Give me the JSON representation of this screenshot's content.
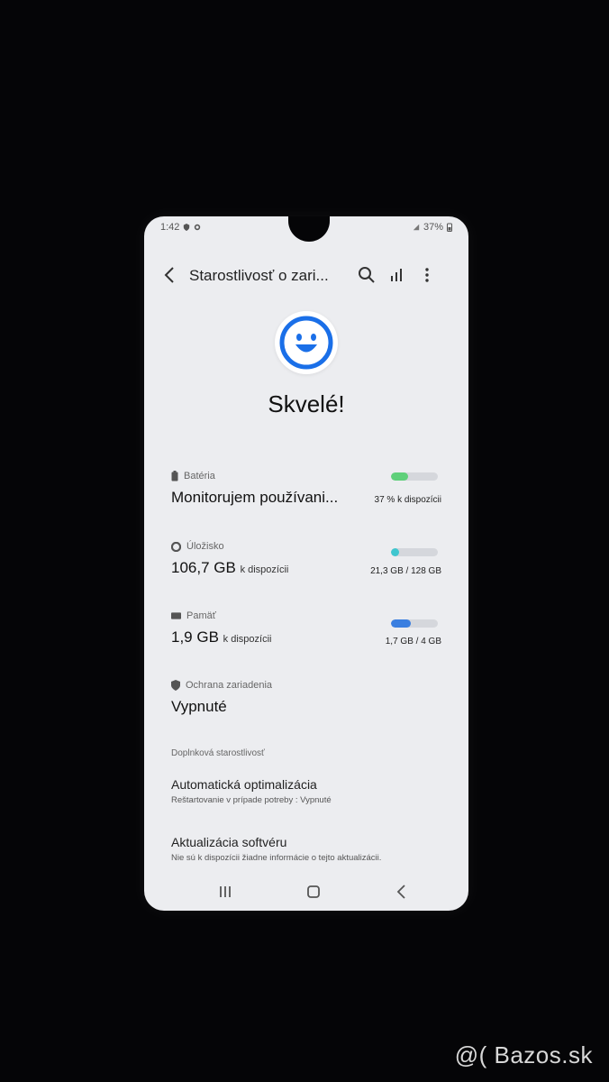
{
  "status_bar": {
    "time": "1:42",
    "battery": "37%"
  },
  "toolbar": {
    "title": "Starostlivosť o zari..."
  },
  "hero": {
    "status_text": "Skvelé!"
  },
  "battery": {
    "label": "Batéria",
    "value": "Monitorujem používani...",
    "meta": "37 % k dispozícii",
    "fill_fraction": 0.37,
    "color": "#5fd07a"
  },
  "storage": {
    "label": "Úložisko",
    "value": "106,7 GB",
    "unit": "k dispozícii",
    "meta": "21,3 GB / 128 GB",
    "fill_fraction": 0.17,
    "color": "#3fc6cf"
  },
  "memory": {
    "label": "Pamäť",
    "value": "1,9 GB",
    "unit": "k dispozícii",
    "meta": "1,7 GB / 4 GB",
    "fill_fraction": 0.43,
    "color": "#3b7fe0"
  },
  "protection": {
    "label": "Ochrana zariadenia",
    "value": "Vypnuté"
  },
  "additional": {
    "header": "Doplnková starostlivosť",
    "items": [
      {
        "title": "Automatická optimalizácia",
        "desc": "Reštartovanie v prípade potreby : Vypnuté"
      },
      {
        "title": "Aktualizácia softvéru",
        "desc": "Nie sú k dispozícii žiadne informácie o tejto aktualizácii."
      }
    ]
  },
  "watermark": "@( Bazos.sk",
  "colors": {
    "accent": "#1a6fe8",
    "background": "#ecedf0"
  }
}
